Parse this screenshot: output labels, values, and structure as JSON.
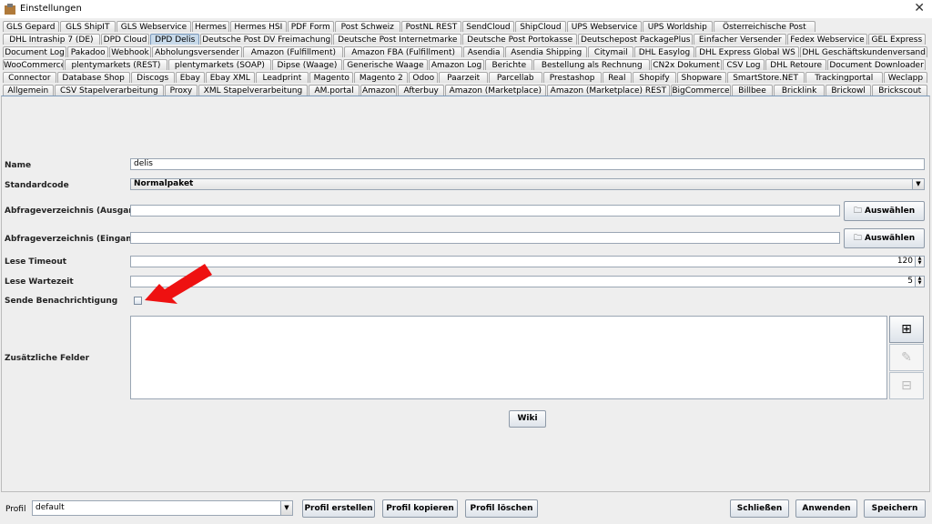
{
  "window": {
    "title": "Einstellungen",
    "close_glyph": "✕",
    "icon": "app-icon"
  },
  "tab_rows": [
    [
      "GLS Gepard",
      "GLS ShipIT",
      "GLS Webservice",
      "Hermes",
      "Hermes HSI",
      "PDF Form",
      "Post Schweiz",
      "PostNL REST",
      "SendCloud",
      "ShipCloud",
      "UPS Webservice",
      "UPS Worldship",
      "Österreichische Post"
    ],
    [
      "DHL Intraship 7 (DE)",
      "DPD Cloud",
      "DPD Delis",
      "Deutsche Post DV Freimachung",
      "Deutsche Post Internetmarke",
      "Deutsche Post Portokasse",
      "Deutschepost PackagePlus",
      "Einfacher Versender",
      "Fedex Webservice",
      "GEL Express"
    ],
    [
      "Document Log",
      "Pakadoo",
      "Webhook",
      "Abholungsversender",
      "Amazon (Fulfillment)",
      "Amazon FBA (Fulfillment)",
      "Asendia",
      "Asendia Shipping",
      "Citymail",
      "DHL Easylog",
      "DHL Express Global WS",
      "DHL Geschäftskundenversand"
    ],
    [
      "WooCommerce",
      "plentymarkets (REST)",
      "plentymarkets (SOAP)",
      "Dipse (Waage)",
      "Generische Waage",
      "Amazon Log",
      "Berichte",
      "Bestellung als Rechnung",
      "CN2x Dokument",
      "CSV Log",
      "DHL Retoure",
      "Document Downloader"
    ],
    [
      "Connector",
      "Database Shop",
      "Discogs",
      "Ebay",
      "Ebay XML",
      "Leadprint",
      "Magento",
      "Magento 2",
      "Odoo",
      "Paarzeit",
      "Parcellab",
      "Prestashop",
      "Real",
      "Shopify",
      "Shopware",
      "SmartStore.NET",
      "Trackingportal",
      "Weclapp"
    ],
    [
      "Allgemein",
      "CSV Stapelverarbeitung",
      "Proxy",
      "XML Stapelverarbeitung",
      "AM.portal",
      "Amazon",
      "Afterbuy",
      "Amazon (Marketplace)",
      "Amazon (Marketplace) REST",
      "BigCommerce",
      "Billbee",
      "Bricklink",
      "Brickowl",
      "Brickscout"
    ]
  ],
  "selected_tab": "DPD Delis",
  "form": {
    "name_label": "Name",
    "name_value": "delis",
    "standardcode_label": "Standardcode",
    "standardcode_value": "Normalpaket",
    "out_dir_label": "Abfrageverzeichnis (Ausgang) *",
    "out_dir_value": "",
    "in_dir_label": "Abfrageverzeichnis (Eingang) *",
    "in_dir_value": "",
    "choose_label": "Auswählen",
    "timeout_label": "Lese Timeout",
    "timeout_value": "120",
    "wait_label": "Lese Wartezeit",
    "wait_value": "5",
    "notify_label": "Sende Benachrichtigung",
    "notify_checked": false,
    "extra_label": "Zusätzliche Felder",
    "wiki_label": "Wiki"
  },
  "footer": {
    "profil_label": "Profil",
    "profil_value": "default",
    "create_label": "Profil erstellen",
    "copy_label": "Profil kopieren",
    "delete_label": "Profil löschen",
    "close_label": "Schließen",
    "apply_label": "Anwenden",
    "save_label": "Speichern"
  },
  "annotation": {
    "color": "#ee1111"
  }
}
